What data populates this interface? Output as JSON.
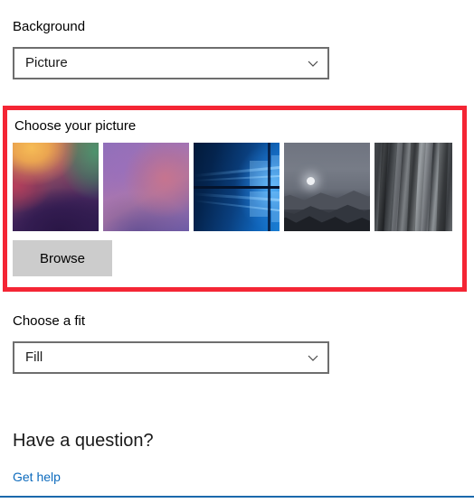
{
  "background_section": {
    "label": "Background",
    "dropdown": {
      "value": "Picture",
      "chevron_icon": "chevron-down-icon"
    }
  },
  "picture_section": {
    "label": "Choose your picture",
    "highlight_color": "#f42534",
    "thumbnails": [
      {
        "name": "abstract-sunrise-bloom",
        "alt": "Abstract orange green and purple gradient wallpaper"
      },
      {
        "name": "abstract-violet-haze",
        "alt": "Soft violet and pink gradient wallpaper"
      },
      {
        "name": "windows-10-hero",
        "alt": "Windows 10 blue hero light rays wallpaper"
      },
      {
        "name": "moonlit-mountains",
        "alt": "Grayscale moonlit mountain landscape wallpaper"
      },
      {
        "name": "granite-cliff",
        "alt": "Grayscale granite rock cliff wallpaper"
      }
    ],
    "browse_button": "Browse"
  },
  "fit_section": {
    "label": "Choose a fit",
    "dropdown": {
      "value": "Fill",
      "chevron_icon": "chevron-down-icon"
    }
  },
  "footer": {
    "heading": "Have a question?",
    "link": "Get help",
    "link_color": "#0d6bbd"
  }
}
